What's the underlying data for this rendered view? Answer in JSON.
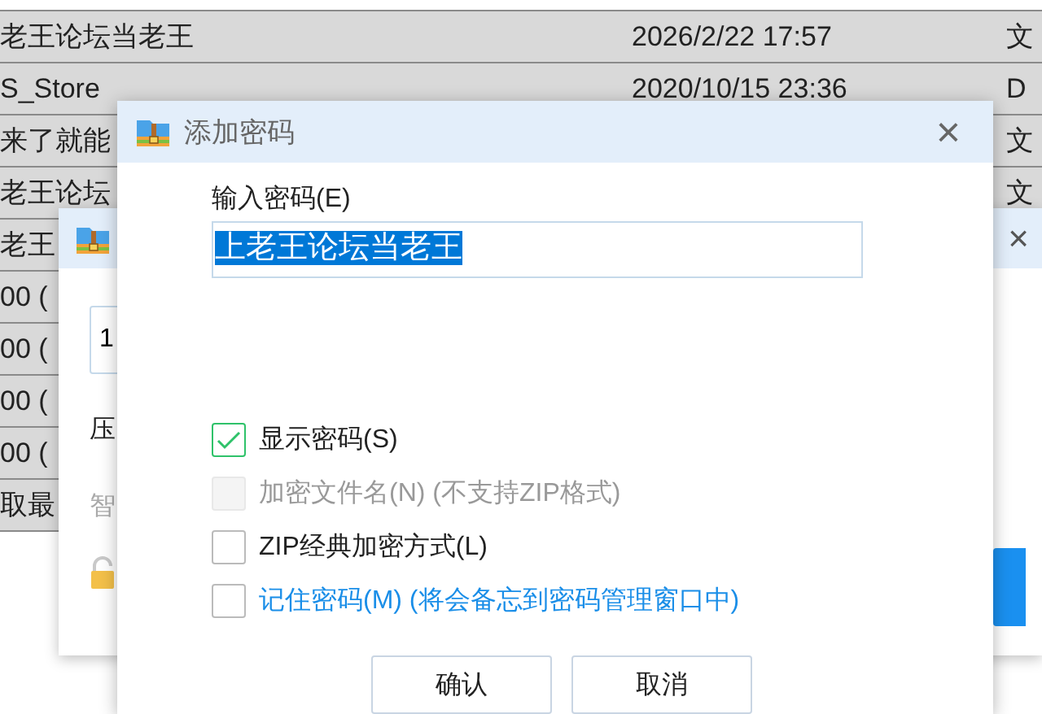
{
  "file_list": {
    "rows": [
      {
        "name": "老王论坛当老王",
        "date": "2026/2/22 17:57",
        "type": "文"
      },
      {
        "name": "S_Store",
        "date": "2020/10/15 23:36",
        "type": "D"
      },
      {
        "name": "来了就能",
        "type": "文"
      },
      {
        "name": "老王论坛",
        "type": "文"
      },
      {
        "name": "老王"
      },
      {
        "name": "00 ("
      },
      {
        "name": "00 ("
      },
      {
        "name": "00 ("
      },
      {
        "name": "00 ("
      },
      {
        "name": "取最"
      }
    ]
  },
  "back_dialog": {
    "close": "×",
    "field_value": "1",
    "label": "压",
    "hint": "智"
  },
  "password_dialog": {
    "title": "添加密码",
    "close": "×",
    "field_label": "输入密码(E)",
    "value": "上老王论坛当老王",
    "options": [
      {
        "kind": "plain",
        "label": "显示密码(S)",
        "checked": true,
        "disabled": false
      },
      {
        "kind": "plain",
        "label": "加密文件名(N) (不支持ZIP格式)",
        "checked": false,
        "disabled": true
      },
      {
        "kind": "plain",
        "label": "ZIP经典加密方式(L)",
        "checked": false,
        "disabled": false
      },
      {
        "kind": "link",
        "label": "记住密码(M) (将会备忘到密码管理窗口中)",
        "checked": false,
        "disabled": false
      }
    ],
    "buttons": [
      "确认",
      "取消"
    ]
  }
}
